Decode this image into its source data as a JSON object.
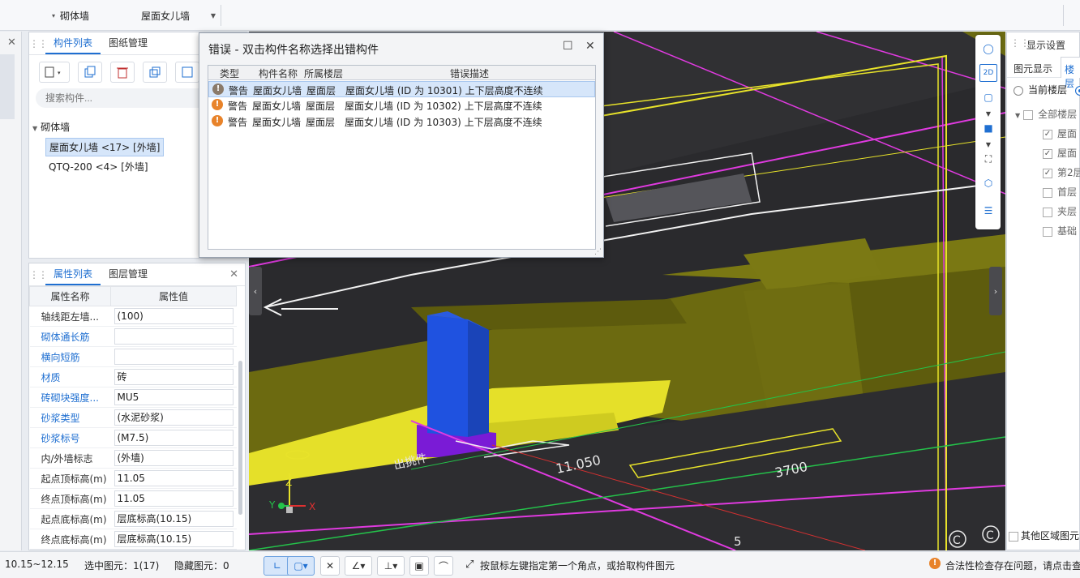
{
  "topbar": {
    "combo1": "砌体墙",
    "combo2": "屋面女儿墙"
  },
  "component_panel": {
    "tabs": [
      "构件列表",
      "图纸管理"
    ],
    "search_placeholder": "搜索构件...",
    "category": "砌体墙",
    "items": [
      "屋面女儿墙 <17> [外墙]",
      "QTQ-200 <4> [外墙]"
    ]
  },
  "property_panel": {
    "tabs": [
      "属性列表",
      "图层管理"
    ],
    "headers": [
      "属性名称",
      "属性值"
    ],
    "rows": [
      {
        "name": "轴线距左墙...",
        "value": "(100)",
        "link": false
      },
      {
        "name": "砌体通长筋",
        "value": "",
        "link": true
      },
      {
        "name": "横向短筋",
        "value": "",
        "link": true
      },
      {
        "name": "材质",
        "value": "砖",
        "link": true
      },
      {
        "name": "砖砌块强度...",
        "value": "MU5",
        "link": true
      },
      {
        "name": "砂浆类型",
        "value": "(水泥砂浆)",
        "link": true
      },
      {
        "name": "砂浆标号",
        "value": "(M7.5)",
        "link": true
      },
      {
        "name": "内/外墙标志",
        "value": "(外墙)",
        "link": false
      },
      {
        "name": "起点顶标高(m)",
        "value": "11.05",
        "link": false
      },
      {
        "name": "终点顶标高(m)",
        "value": "11.05",
        "link": false
      },
      {
        "name": "起点底标高(m)",
        "value": "层底标高(10.15)",
        "link": false
      },
      {
        "name": "终点底标高(m)",
        "value": "层底标高(10.15)",
        "link": false
      }
    ]
  },
  "dialog": {
    "title": "错误 - 双击构件名称选择出错构件",
    "columns": [
      "类型",
      "构件名称",
      "所属楼层",
      "错误描述"
    ],
    "rows": [
      {
        "type": "警告",
        "name": "屋面女儿墙",
        "floor": "屋面层",
        "desc": "屋面女儿墙 (ID 为 10301) 上下层高度不连续"
      },
      {
        "type": "警告",
        "name": "屋面女儿墙",
        "floor": "屋面层",
        "desc": "屋面女儿墙 (ID 为 10302) 上下层高度不连续"
      },
      {
        "type": "警告",
        "name": "屋面女儿墙",
        "floor": "屋面层",
        "desc": "屋面女儿墙 (ID 为 10303) 上下层高度不连续"
      }
    ]
  },
  "viewport": {
    "dim_labels": [
      "11.050",
      "3700",
      "出挑件",
      "5",
      "C",
      "C"
    ],
    "axis": {
      "x": "X",
      "y": "Y",
      "z": "Z"
    }
  },
  "display_panel": {
    "title": "显示设置",
    "tabs": [
      "图元显示",
      "楼层"
    ],
    "radio": "当前楼层",
    "floors": [
      "全部楼层",
      "屋面",
      "屋面",
      "第2层",
      "首层",
      "夹层",
      "基础"
    ],
    "bottom_check": "其他区域图元"
  },
  "status": {
    "floor_range": "10.15~12.15",
    "selected": "选中图元：1(17)",
    "hidden": "隐藏图元：0",
    "hint": "按鼠标左键指定第一个角点，或拾取构件图元",
    "warning": "合法性检查存在问题，请点击查"
  }
}
